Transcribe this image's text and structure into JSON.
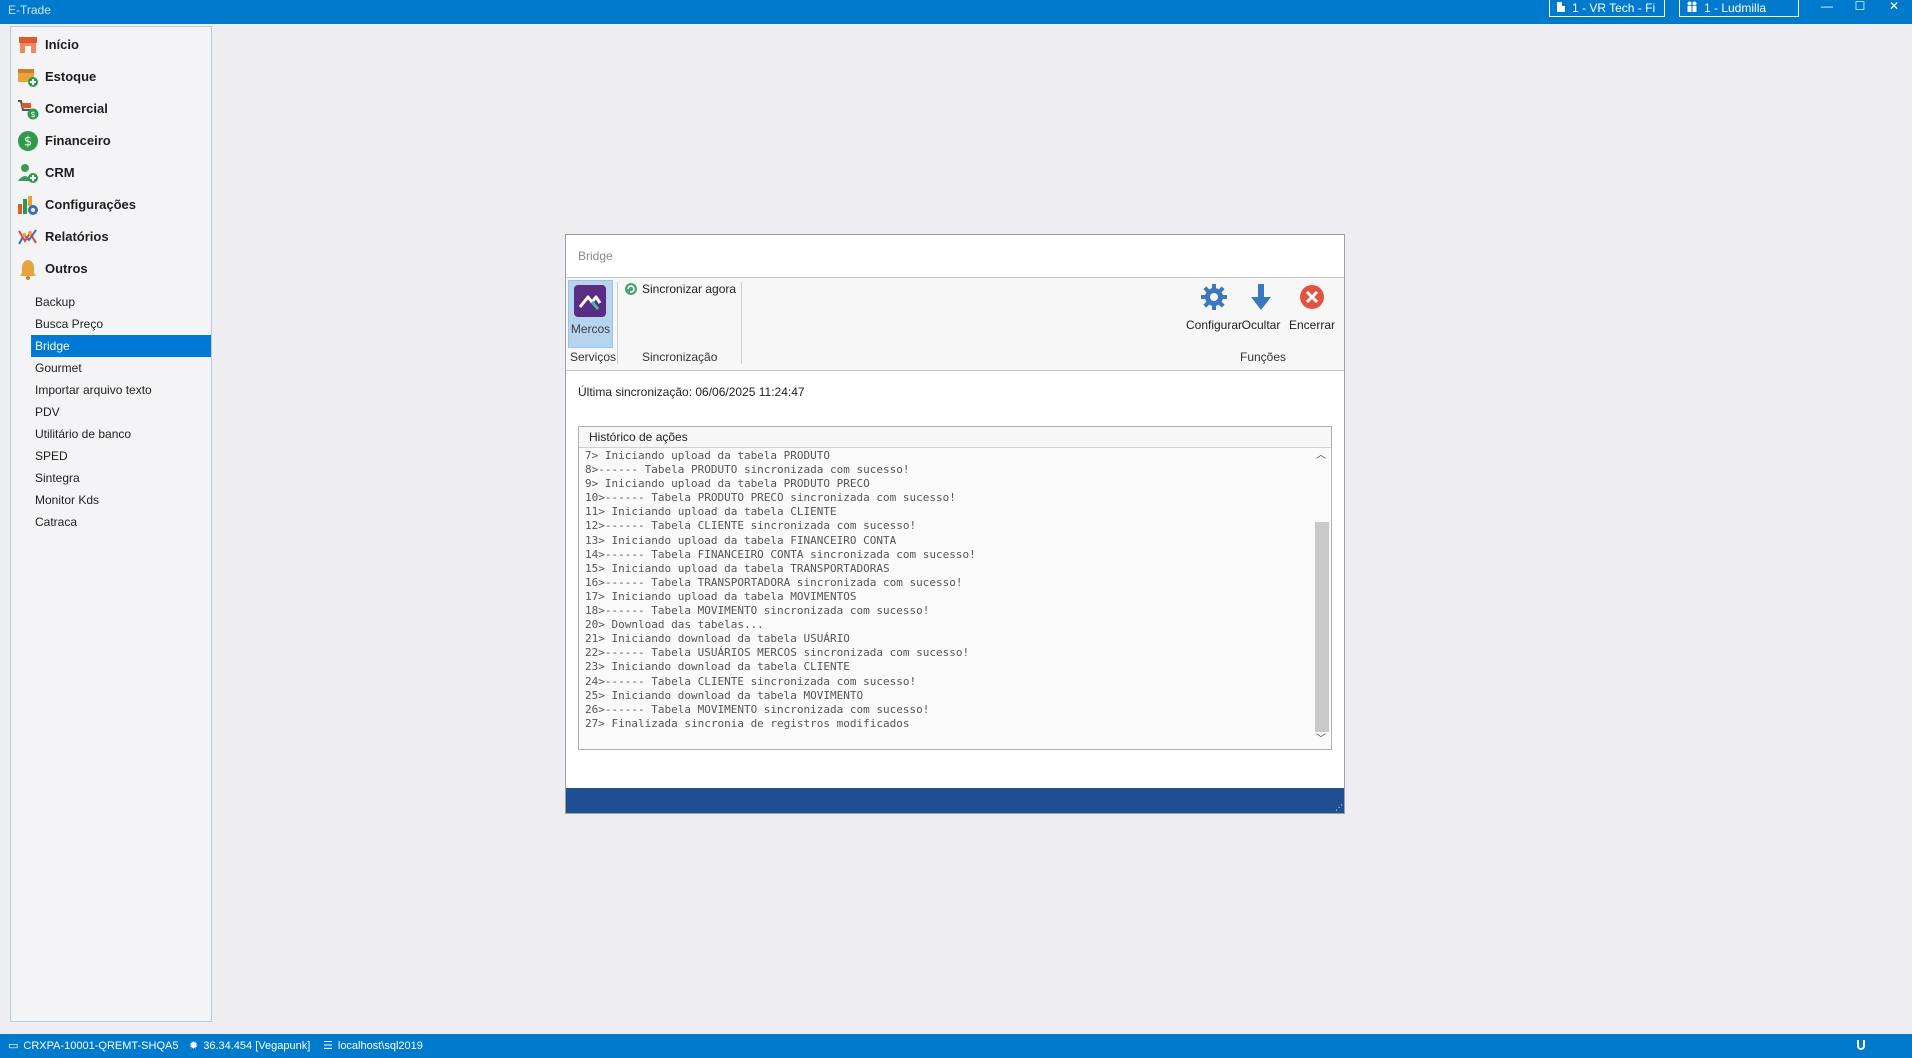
{
  "window": {
    "app_title": "E-Trade",
    "company_label": "1 - VR Tech - Fi",
    "user_label": "1 - Ludmilla",
    "minimize_glyph": "—",
    "maximize_glyph": "☐",
    "close_glyph": "✕"
  },
  "sidebar": {
    "menu": [
      {
        "label": "Início",
        "icon": "store-icon",
        "color": "#e05a2b"
      },
      {
        "label": "Estoque",
        "icon": "box-add-icon",
        "color": "#e8a33d"
      },
      {
        "label": "Comercial",
        "icon": "cart-money-icon",
        "color": "#2f9a4a"
      },
      {
        "label": "Financeiro",
        "icon": "dollar-icon",
        "color": "#2f9a4a"
      },
      {
        "label": "CRM",
        "icon": "user-add-icon",
        "color": "#2f9a4a"
      },
      {
        "label": "Configurações",
        "icon": "chart-gear-icon",
        "color": "#3a6fb7"
      },
      {
        "label": "Relatórios",
        "icon": "graph-icon",
        "color": "#d9473a"
      },
      {
        "label": "Outros",
        "icon": "bell-icon",
        "color": "#e8a33d"
      }
    ],
    "submenu": [
      {
        "label": "Backup"
      },
      {
        "label": "Busca Preço"
      },
      {
        "label": "Bridge",
        "active": true
      },
      {
        "label": "Gourmet"
      },
      {
        "label": "Importar arquivo texto"
      },
      {
        "label": "PDV"
      },
      {
        "label": "Utilitário de banco"
      },
      {
        "label": "SPED"
      },
      {
        "label": "Sintegra"
      },
      {
        "label": "Monitor Kds"
      },
      {
        "label": "Catraca"
      }
    ]
  },
  "bridge": {
    "title": "Bridge",
    "ribbon": {
      "mercos_label": "Mercos",
      "services_group": "Serviços",
      "sync_now_label": "Sincronizar agora",
      "sync_group": "Sincronização",
      "configure_label": "Configurar",
      "hide_label": "Ocultar",
      "close_label": "Encerrar",
      "functions_group": "Funções"
    },
    "last_sync_label": "Última sincronização: 06/06/2025 11:24:47",
    "history_title": "Histórico de ações",
    "log": [
      "7> Iniciando upload da tabela PRODUTO",
      "8>------ Tabela PRODUTO sincronizada com sucesso!",
      "9> Iniciando upload da tabela PRODUTO PRECO",
      "10>------ Tabela PRODUTO PRECO sincronizada com sucesso!",
      "11> Iniciando upload da tabela CLIENTE",
      "12>------ Tabela CLIENTE sincronizada com sucesso!",
      "13> Iniciando upload da tabela FINANCEIRO CONTA",
      "14>------ Tabela FINANCEIRO CONTA sincronizada com sucesso!",
      "15> Iniciando upload da tabela TRANSPORTADORAS",
      "16>------ Tabela TRANSPORTADORA sincronizada com sucesso!",
      "17> Iniciando upload da tabela MOVIMENTOS",
      "18>------ Tabela MOVIMENTO sincronizada com sucesso!",
      "20> Download das tabelas...",
      "21> Iniciando download da tabela USUÁRIO",
      "22>------ Tabela USUÁRIOS MERCOS sincronizada com sucesso!",
      "23> Iniciando download da tabela CLIENTE",
      "24>------ Tabela CLIENTE sincronizada com sucesso!",
      "25> Iniciando download da tabela MOVIMENTO",
      "26>------ Tabela MOVIMENTO sincronizada com sucesso!",
      "27> Finalizada sincronia de registros modificados"
    ]
  },
  "statusbar": {
    "terminal": "CRXPA-10001-QREMT-SHQA5",
    "version": "36.34.454 [Vegapunk]",
    "database": "localhost\\sql2019"
  },
  "colors": {
    "titlebar": "#007acc",
    "active_item": "#0078d4",
    "footer_band": "#1f4e91"
  }
}
